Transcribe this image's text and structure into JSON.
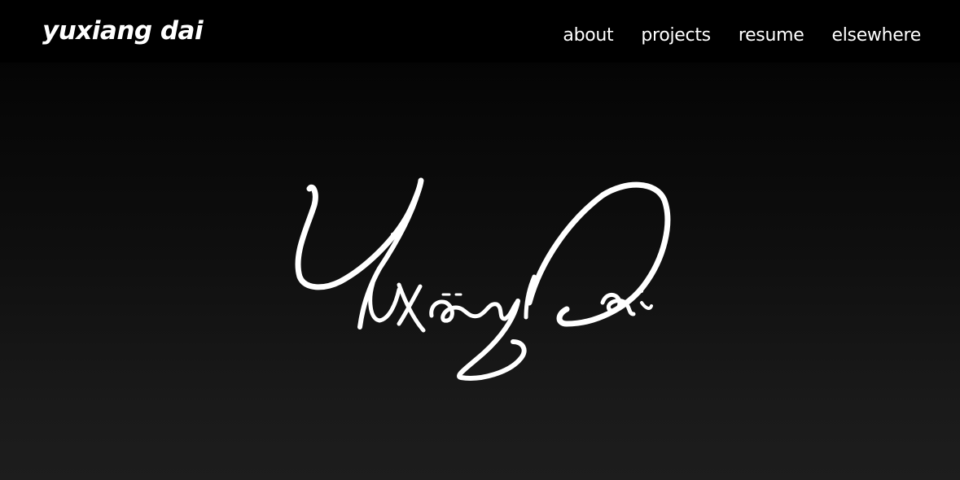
{
  "header": {
    "site_title": "yuxiang dai",
    "nav": [
      {
        "label": "about"
      },
      {
        "label": "projects"
      },
      {
        "label": "resume"
      },
      {
        "label": "elsewhere"
      }
    ]
  },
  "hero": {
    "signature_text": "yuxiang dai",
    "signature_kind": "handwritten-signature"
  },
  "colors": {
    "header_bg": "#000000",
    "text": "#ffffff",
    "hero_gradient_top": "#000000",
    "hero_gradient_bottom": "#1d1d1d"
  }
}
